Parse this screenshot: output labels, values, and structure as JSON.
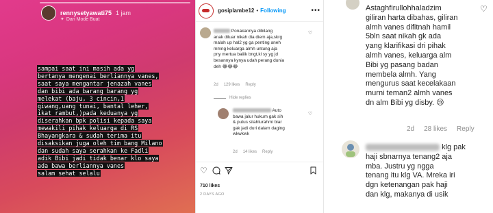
{
  "story": {
    "username": "rennysetyawati75",
    "time": "1 jam",
    "mode": "Dari Mode Buat",
    "mode_icon": "sparkle-icon",
    "lines": [
      "sampai saat ini masih ada yg",
      "bertanya mengenai berliannya vanes,",
      "saat saya mengantar jenazah vanes",
      "dan bibi ada  barang barang yg",
      "melekat (baju, 3 cincin,1",
      "giwang,uang tunai, bantal leher,",
      "ikat rambut,)pada keduanya yg",
      "diserahkan bpk polisi kepada saya",
      "mewakili pihak keluarga di RS",
      "Bhayangkara & sudah terima itu",
      "disaksikan juga oleh tim bang Milano",
      "dan sudah saya serahkan ke Fadli",
      "adik Bibi jadi tidak benar klo saya",
      "ada bawa berliannya vanes",
      "salam sehat selalu"
    ]
  },
  "post": {
    "username": "gosiplambe12",
    "separator": "•",
    "follow_label": "Following",
    "more_icon": "more-icon",
    "comment1": {
      "lines": [
        "Ponakannya dibilang",
        "anak diluar nikah dia diem aja,skrg",
        "malah up hal2 yg ga penting aneh",
        "mmng keluarga almh untung aja",
        "pny mertua baiiik bngt,kl sy yg jd",
        "besannya kynya udah perang dunia",
        "deh 😂😂😂"
      ],
      "time": "2d",
      "likes": "129 likes",
      "reply": "Reply"
    },
    "hide_replies": "Hide replies",
    "comment2": {
      "lines": [
        "Auto",
        "bawa jalur hukum gak sih",
        "& putus silahturahmi biar",
        "gak jadi duri dalam daging",
        "wkwkwk"
      ],
      "time": "2d",
      "likes": "14 likes",
      "reply": "Reply"
    },
    "likes_count": "710 likes",
    "posted": "2 DAYS AGO"
  },
  "zoom": {
    "comment1": {
      "lines": [
        "Astaghfirullohhaladzim",
        "giliran harta dibahas, giliran",
        "almh vanes difitnah hamil",
        "5bln saat nikah gk ada",
        "yang klarifikasi dri pihak",
        "almh vanes, keluarga alm",
        "Bibi yg pasang badan",
        "membela almh. Yang",
        "mengurus saat kecelakaan",
        "murni teman2 almh vanes",
        "dn alm Bibi yg disby. 😢"
      ],
      "time": "2d",
      "likes": "28 likes",
      "reply": "Reply"
    },
    "comment2": {
      "first": "klg pak",
      "lines": [
        "haji sbnarnya tenang2 aja",
        "mba. Justru yg ngga",
        "tenang itu klg VA. Mreka iri",
        "dgn ketenangan pak haji",
        "dan klg, makanya di usik"
      ]
    }
  }
}
